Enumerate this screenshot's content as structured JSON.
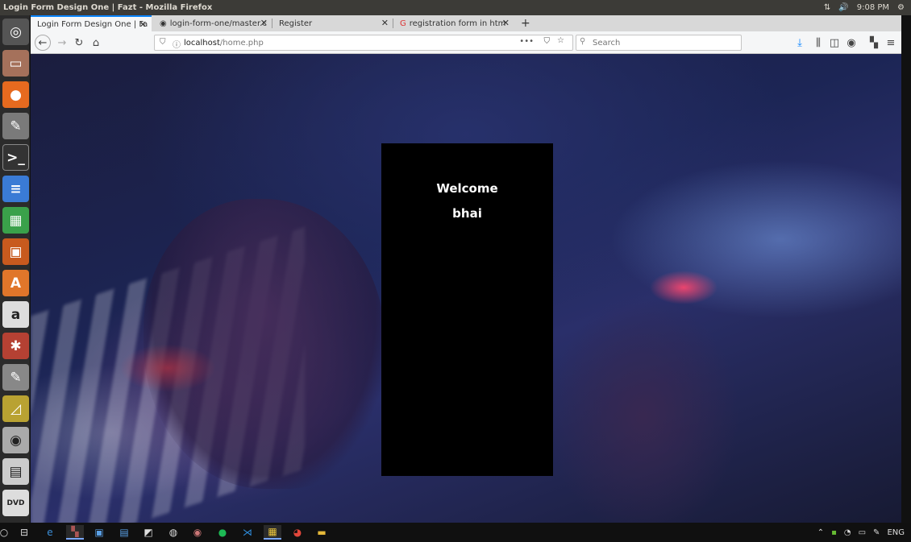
{
  "topbar": {
    "window_title": "Login Form Design One | Fazt - Mozilla Firefox",
    "time": "9:08 PM"
  },
  "launcher": {
    "items": [
      "ubuntu-dash",
      "files",
      "firefox",
      "text-editor",
      "terminal",
      "writer",
      "calc",
      "impress",
      "software-center",
      "amazon",
      "settings",
      "editor",
      "presentation",
      "screenshot",
      "save",
      "dvd"
    ]
  },
  "browser": {
    "tabs": [
      {
        "label": "Login Form Design One | Fa"
      },
      {
        "label": "login-form-one/master.c"
      },
      {
        "label": "Register"
      },
      {
        "label": "registration form in htm"
      }
    ],
    "url_host": "localhost",
    "url_path": "/home.php",
    "search_placeholder": "Search"
  },
  "page": {
    "welcome_text": "Welcome",
    "username": "bhai"
  },
  "taskbar": {
    "language": "ENG"
  },
  "colors": {
    "accent": "#0a84ff",
    "card": "#000000"
  }
}
